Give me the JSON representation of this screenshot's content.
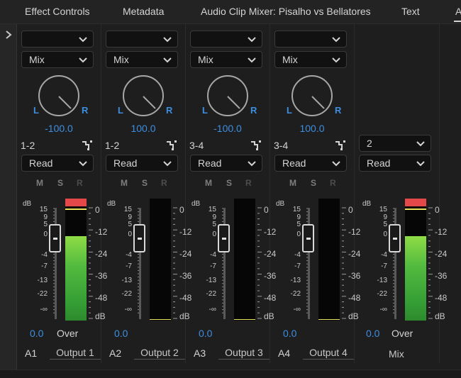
{
  "tabs": [
    {
      "label": "Effect Controls"
    },
    {
      "label": "Metadata"
    },
    {
      "label": "Audio Clip Mixer: Pisalho vs Bellatores"
    },
    {
      "label": "Text"
    },
    {
      "label": "A"
    }
  ],
  "channels": [
    {
      "input": "",
      "mode": "Mix",
      "pan": "-100.0",
      "route": "1-2",
      "automation": "Read",
      "m": "M",
      "s": "S",
      "r": "R",
      "db_top": "dB",
      "volume": "0.0",
      "over": "Over",
      "track": "A1",
      "output": "Output 1",
      "level": 0.9,
      "peak": true
    },
    {
      "input": "",
      "mode": "Mix",
      "pan": "100.0",
      "route": "1-2",
      "automation": "Read",
      "m": "M",
      "s": "S",
      "r": "R",
      "db_top": "dB",
      "volume": "0.0",
      "over": "",
      "track": "A2",
      "output": "Output 2",
      "level": 0.0,
      "peak": false
    },
    {
      "input": "",
      "mode": "Mix",
      "pan": "-100.0",
      "route": "3-4",
      "automation": "Read",
      "m": "M",
      "s": "S",
      "r": "R",
      "db_top": "dB",
      "volume": "0.0",
      "over": "",
      "track": "A3",
      "output": "Output 3",
      "level": 0.0,
      "peak": false
    },
    {
      "input": "",
      "mode": "Mix",
      "pan": "100.0",
      "route": "3-4",
      "automation": "Read",
      "m": "M",
      "s": "S",
      "r": "R",
      "db_top": "dB",
      "volume": "0.0",
      "over": "",
      "track": "A4",
      "output": "Output 4",
      "level": 0.0,
      "peak": false
    }
  ],
  "master": {
    "channels": "2",
    "automation": "Read",
    "db_top": "dB",
    "volume": "0.0",
    "over": "Over",
    "label": "Mix",
    "level": 0.9,
    "peak": true
  },
  "fader_scale": [
    "15",
    "9",
    "5",
    "0",
    "-4",
    "-7",
    "-13",
    "-22",
    "-∞"
  ],
  "meter_scale": [
    "0",
    "-12",
    "-24",
    "-36",
    "-48",
    "dB"
  ],
  "colors": {
    "accent_blue": "#3d8ee0",
    "meter_green": "#53bb3f",
    "peak_red": "#e54848",
    "peak_yellow": "#e8e35e"
  }
}
